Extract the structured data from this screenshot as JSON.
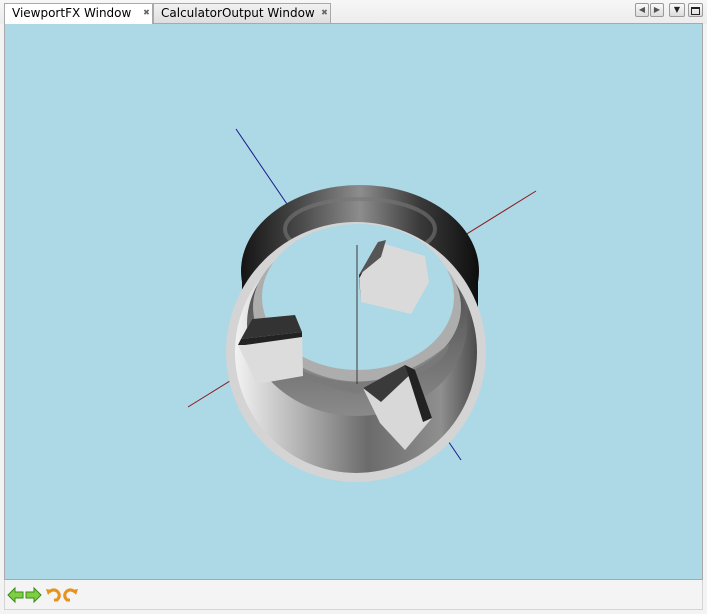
{
  "tabs": [
    {
      "label": "ViewportFX Window",
      "active": true
    },
    {
      "label": "CalculatorOutput Window",
      "active": false
    }
  ],
  "tab_controls": {
    "scroll_left_icon": "triangle-left",
    "scroll_right_icon": "triangle-right",
    "list_icon": "triangle-down",
    "maximize_icon": "window-restore"
  },
  "viewport": {
    "background": "#add8e6",
    "scene": "3d-ring-with-three-cubes-and-axes",
    "axis_colors": {
      "x": "#8b1a1a",
      "y": "#3a3a3a",
      "z": "#1a1a8b"
    }
  },
  "toolbar": {
    "buttons": [
      {
        "icon": "arrow-left-icon",
        "color": "#5cb82e"
      },
      {
        "icon": "arrow-right-icon",
        "color": "#5cb82e"
      },
      {
        "icon": "undo-icon",
        "color": "#e8921e"
      },
      {
        "icon": "redo-icon",
        "color": "#e8921e"
      }
    ]
  }
}
